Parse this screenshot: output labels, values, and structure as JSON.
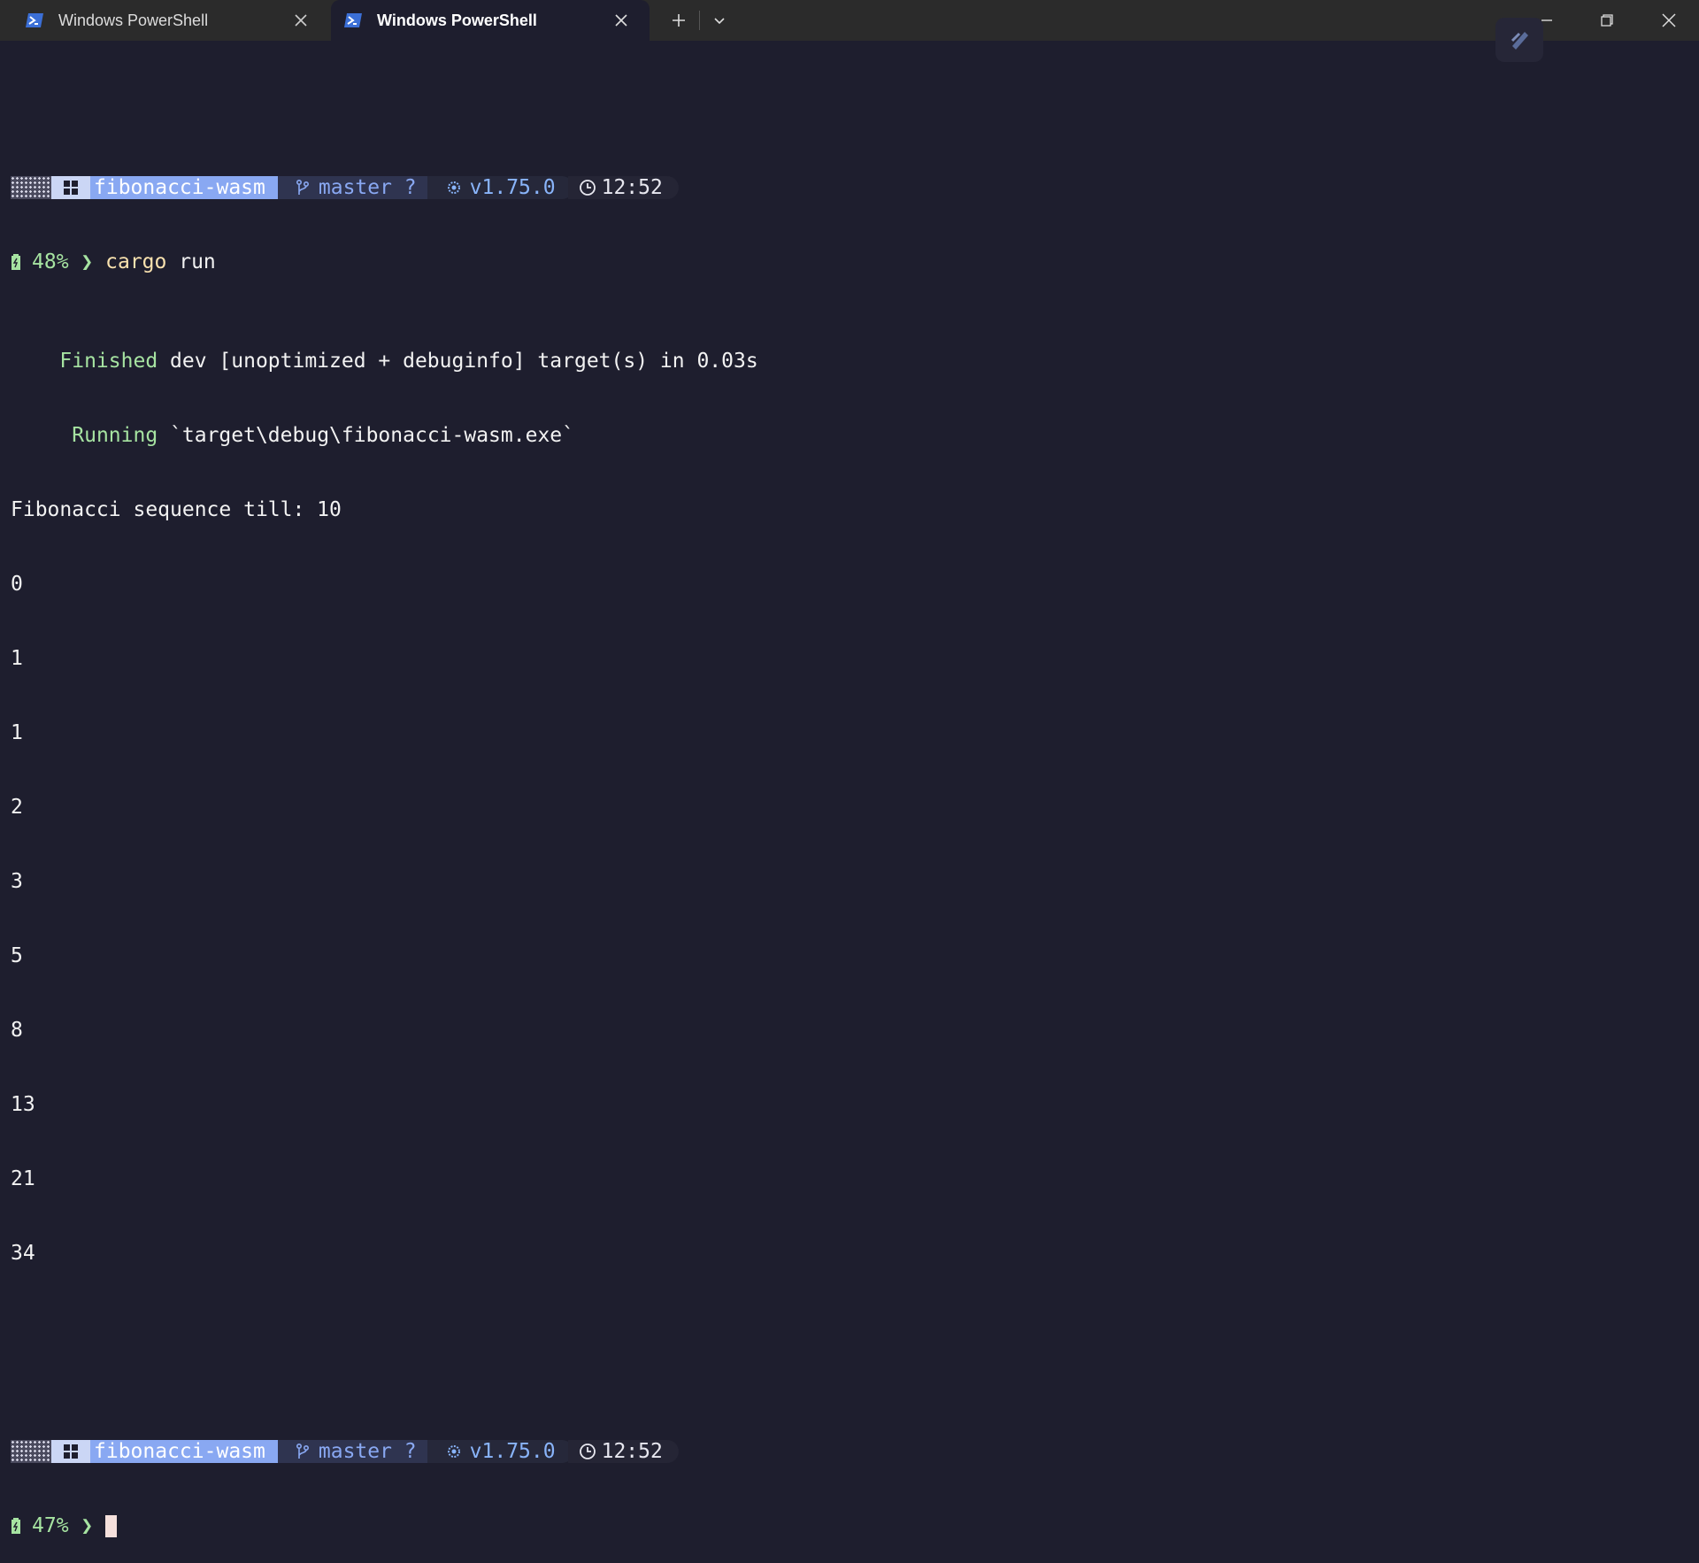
{
  "tabs": [
    {
      "label": "Windows PowerShell",
      "active": false
    },
    {
      "label": "Windows PowerShell",
      "active": true
    }
  ],
  "colors": {
    "background": "#1e1e2e",
    "titlebar": "#2b2b2b",
    "dir_segment": "#89a8f2",
    "git_text": "#89a8f2",
    "success_green": "#a6e3a1",
    "command_yellow": "#f9e2af"
  },
  "prompt1": {
    "dir": "fibonacci-wasm",
    "branch": "master ?",
    "rust_version": "v1.75.0",
    "time": "12:52",
    "battery": "48%",
    "arrow": "❯",
    "command_name": "cargo",
    "command_args": " run"
  },
  "output": {
    "finished_label": "Finished",
    "finished_text": " dev [unoptimized + debuginfo] target(s) in 0.03s",
    "running_label": "Running",
    "running_text": " `target\\debug\\fibonacci-wasm.exe`",
    "heading": "Fibonacci sequence till: 10",
    "numbers": [
      "0",
      "1",
      "1",
      "2",
      "3",
      "5",
      "8",
      "13",
      "21",
      "34"
    ]
  },
  "prompt2": {
    "dir": "fibonacci-wasm",
    "branch": "master ?",
    "rust_version": "v1.75.0",
    "time": "12:52",
    "battery": "47%",
    "arrow": "❯"
  },
  "icons": {
    "tab": "powershell-icon",
    "os": "windows-icon",
    "git": "git-branch-icon",
    "rust": "rust-icon",
    "clock": "clock-icon",
    "battery": "battery-icon"
  }
}
